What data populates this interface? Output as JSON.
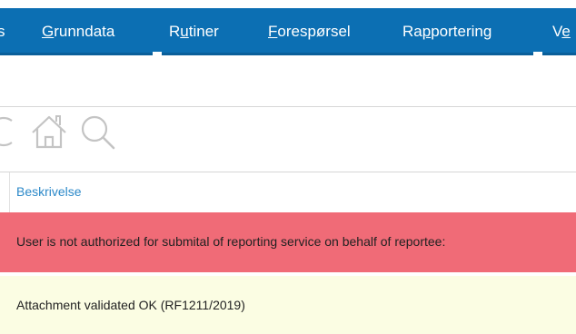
{
  "menu": {
    "items": [
      {
        "prefix": "",
        "mnemonic": "",
        "rest": "s"
      },
      {
        "prefix": "",
        "mnemonic": "G",
        "rest": "runndata"
      },
      {
        "prefix": "R",
        "mnemonic": "u",
        "rest": "tiner"
      },
      {
        "prefix": "",
        "mnemonic": "F",
        "rest": "orespørsel"
      },
      {
        "prefix": "Ra",
        "mnemonic": "p",
        "rest": "portering"
      },
      {
        "prefix": "V",
        "mnemonic": "e",
        "rest": ""
      }
    ]
  },
  "toolbar": {
    "icons": [
      "refresh-icon",
      "home-icon",
      "search-icon"
    ]
  },
  "table": {
    "header": "Beskrivelse",
    "rows": [
      {
        "text": "User is not authorized for submital of reporting service on behalf of reportee:",
        "status": "error"
      },
      {
        "text": "Attachment validated OK (RF1211/2019)",
        "status": "ok"
      }
    ]
  },
  "colors": {
    "menubar": "#0c6fb3",
    "error_row": "#f06b77",
    "ok_row": "#fbfde3",
    "header_link": "#2c89c9"
  }
}
